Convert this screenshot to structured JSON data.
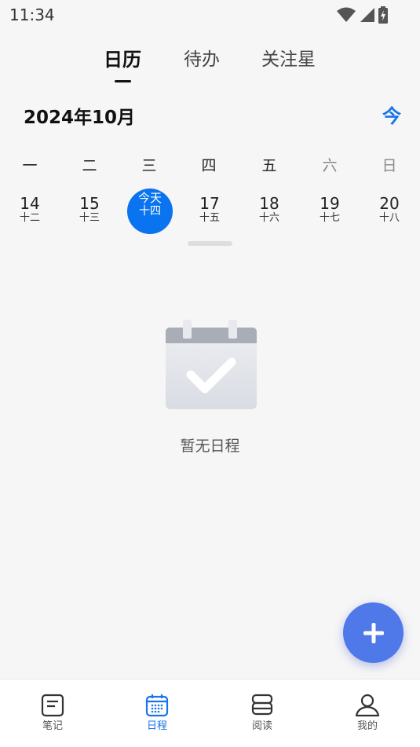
{
  "status_bar": {
    "time": "11:34"
  },
  "tabs": [
    {
      "label": "日历",
      "active": true
    },
    {
      "label": "待办",
      "active": false
    },
    {
      "label": "关注星",
      "active": false
    }
  ],
  "month": {
    "title": "2024年10月",
    "today_button": "今"
  },
  "weekdays": [
    "一",
    "二",
    "三",
    "四",
    "五",
    "六",
    "日"
  ],
  "dates": [
    {
      "day": "14",
      "lunar": "十二"
    },
    {
      "day": "15",
      "lunar": "十三"
    },
    {
      "day": "今天",
      "lunar": "十四",
      "selected": true
    },
    {
      "day": "17",
      "lunar": "十五"
    },
    {
      "day": "18",
      "lunar": "十六"
    },
    {
      "day": "19",
      "lunar": "十七"
    },
    {
      "day": "20",
      "lunar": "十八"
    }
  ],
  "empty_state": {
    "text": "暂无日程",
    "icon": "calendar-check-icon"
  },
  "fab": {
    "icon": "plus-icon"
  },
  "bottom_nav": [
    {
      "label": "笔记",
      "icon": "note-icon",
      "active": false
    },
    {
      "label": "日程",
      "icon": "calendar-icon",
      "active": true
    },
    {
      "label": "阅读",
      "icon": "book-icon",
      "active": false
    },
    {
      "label": "我的",
      "icon": "user-icon",
      "active": false
    }
  ],
  "colors": {
    "accent": "#1a73e8",
    "selected_date": "#0a73ef",
    "fab": "#4f78e8"
  }
}
